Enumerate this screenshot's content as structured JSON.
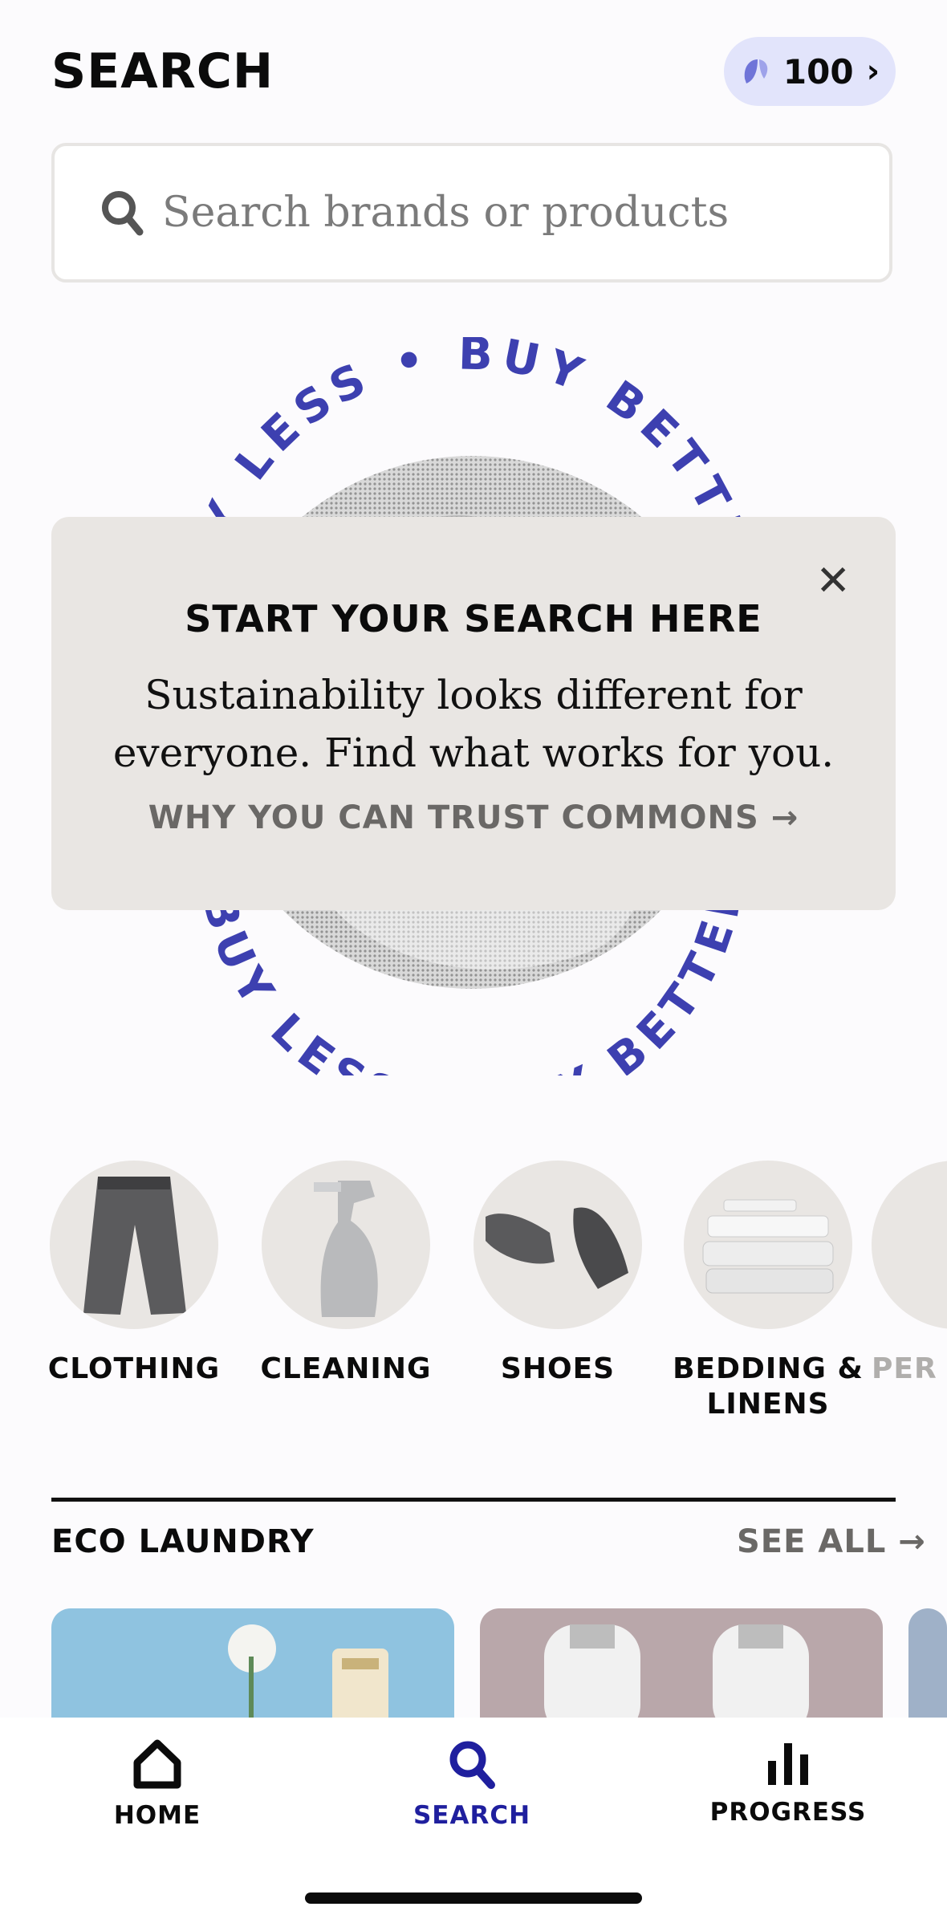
{
  "header": {
    "title": "SEARCH",
    "points": "100"
  },
  "search": {
    "placeholder": "Search brands or products"
  },
  "hero": {
    "ring_text": "BUY LESS • BUY BETTER •"
  },
  "tip": {
    "heading": "START YOUR SEARCH HERE",
    "body": "Sustainability looks different for everyone. Find what works for you.",
    "link": "WHY YOU CAN TRUST COMMONS →"
  },
  "categories": [
    {
      "label": "CLOTHING"
    },
    {
      "label": "CLEANING"
    },
    {
      "label": "SHOES"
    },
    {
      "label": "BEDDING &\nLINENS"
    },
    {
      "label": "PER..."
    }
  ],
  "section": {
    "title": "ECO LAUNDRY",
    "see_all": "SEE ALL →"
  },
  "tabs": [
    {
      "label": "HOME"
    },
    {
      "label": "SEARCH"
    },
    {
      "label": "PROGRESS"
    }
  ],
  "colors": {
    "accent": "#1f1f9e",
    "ring_text": "#3d40b0",
    "pill_bg": "#e2e4fb",
    "card_bg": "#e9e6e3"
  }
}
